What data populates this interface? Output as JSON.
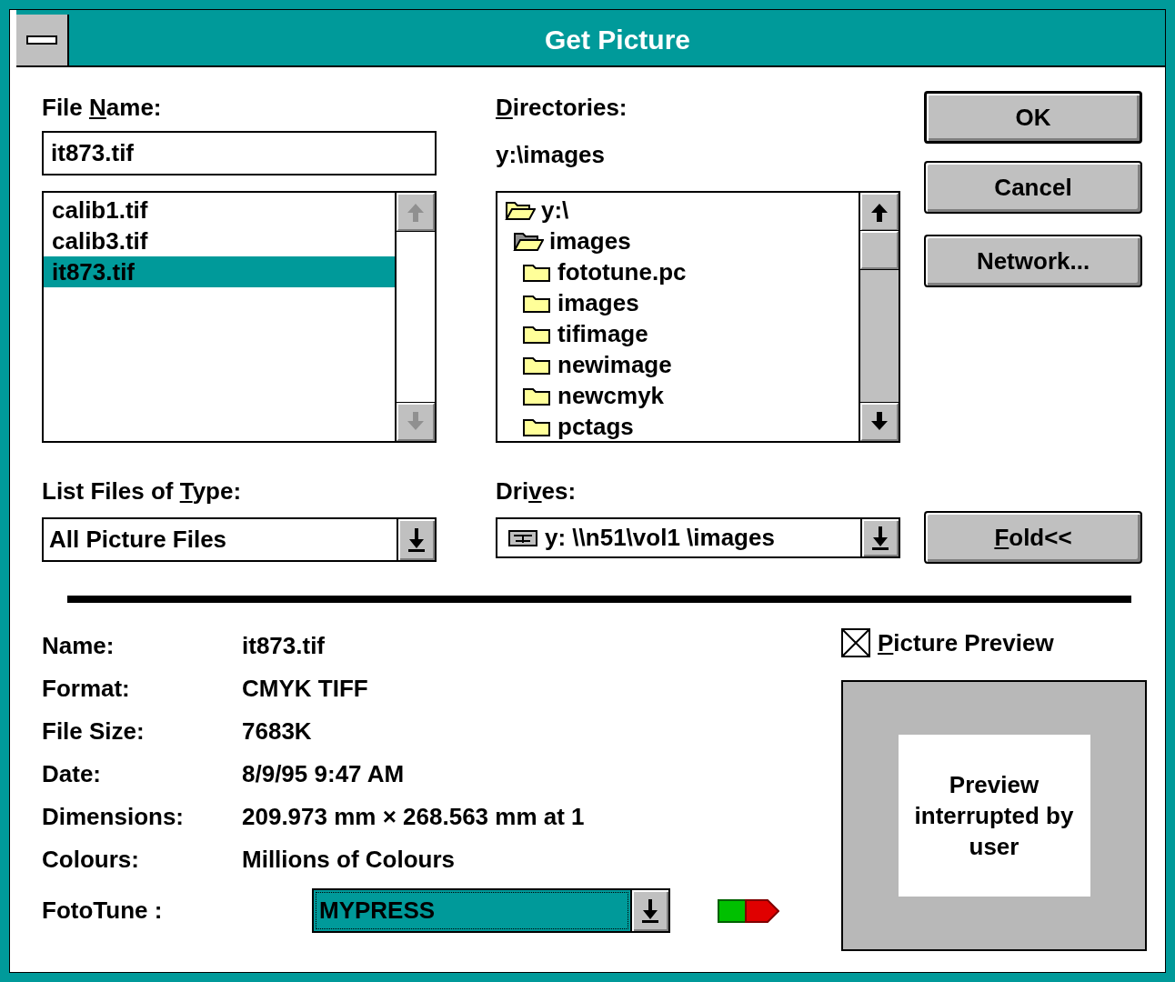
{
  "window": {
    "title": "Get Picture"
  },
  "file_name": {
    "label": [
      {
        "text": "File ",
        "underlined": false
      },
      {
        "text": "N",
        "underlined": true
      },
      {
        "text": "ame:",
        "underlined": false
      }
    ],
    "value": "it873.tif"
  },
  "files": {
    "scroll_enabled": false,
    "items": [
      {
        "name": "calib1.tif",
        "selected": false
      },
      {
        "name": "calib3.tif",
        "selected": false
      },
      {
        "name": "it873.tif",
        "selected": true
      }
    ]
  },
  "directories": {
    "label": [
      {
        "text": "D",
        "underlined": true
      },
      {
        "text": "irectories:",
        "underlined": false
      }
    ],
    "path": "y:\\images",
    "scroll_enabled": true,
    "tree": [
      {
        "name": "y:\\",
        "current": false,
        "children": [
          {
            "name": "images",
            "current": true,
            "children": [
              {
                "name": "fototune.pc",
                "current": false
              },
              {
                "name": "images",
                "current": false
              },
              {
                "name": "tifimage",
                "current": false
              },
              {
                "name": "newimage",
                "current": false
              },
              {
                "name": "newcmyk",
                "current": false
              },
              {
                "name": "pctags",
                "current": false
              }
            ]
          }
        ]
      }
    ]
  },
  "buttons": [
    {
      "label": [
        {
          "text": "OK",
          "underlined": false
        }
      ],
      "default": true
    },
    {
      "label": [
        {
          "text": "Cancel",
          "underlined": false
        }
      ],
      "default": false
    },
    {
      "label": [
        {
          "text": "Network...",
          "underlined": false
        }
      ],
      "default": false
    }
  ],
  "file_type": {
    "label": [
      {
        "text": "List Files of ",
        "underlined": false
      },
      {
        "text": "T",
        "underlined": true
      },
      {
        "text": "ype:",
        "underlined": false
      }
    ],
    "value": "All Picture Files"
  },
  "drives": {
    "label": [
      {
        "text": "Dri",
        "underlined": false
      },
      {
        "text": "v",
        "underlined": true
      },
      {
        "text": "es:",
        "underlined": false
      }
    ],
    "value": "y: \\\\n51\\vol1  \\images"
  },
  "fold_button": {
    "label": [
      {
        "text": "F",
        "underlined": true
      },
      {
        "text": "old<<",
        "underlined": false
      }
    ],
    "default": false
  },
  "info": [
    {
      "label": "Name:",
      "value": "it873.tif"
    },
    {
      "label": "Format:",
      "value": "CMYK TIFF"
    },
    {
      "label": "File Size:",
      "value": "7683K"
    },
    {
      "label": "Date:",
      "value": "8/9/95 9:47 AM"
    },
    {
      "label": "Dimensions:",
      "value": "209.973 mm × 268.563 mm at 1"
    },
    {
      "label": "Colours:",
      "value": "Millions of Colours"
    }
  ],
  "fototune": {
    "label": "FotoTune :",
    "value": "MYPRESS",
    "highlighted": true
  },
  "picture_preview": {
    "label": [
      {
        "text": "P",
        "underlined": true
      },
      {
        "text": "icture Preview",
        "underlined": false
      }
    ],
    "checked": true,
    "message": "Preview interrupted by user"
  }
}
